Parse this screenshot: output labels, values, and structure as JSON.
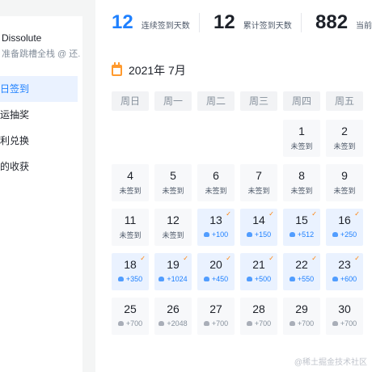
{
  "sidebar": {
    "user_name": "Dissolute",
    "user_motto": "准备跳槽全栈 @ 还...",
    "items": [
      {
        "label": "日签到",
        "active": true
      },
      {
        "label": "运抽奖",
        "active": false
      },
      {
        "label": "利兑换",
        "active": false
      },
      {
        "label": "的收获",
        "active": false
      }
    ]
  },
  "stats": [
    {
      "value": "12",
      "label": "连续签到天数",
      "color": "#1e80ff"
    },
    {
      "value": "12",
      "label": "累计签到天数",
      "color": "#1d2129"
    },
    {
      "value": "882",
      "label": "当前",
      "color": "#1d2129"
    }
  ],
  "calendar": {
    "month_title": "2021年 7月",
    "icon": "calendar-icon",
    "weekdays": [
      "周日",
      "周一",
      "周二",
      "周三",
      "周四",
      "周五"
    ],
    "unsigned_label": "未签到",
    "check_icon": "checkmark-icon",
    "ore_icon": "ore-gem-icon",
    "days": [
      {
        "day": "1",
        "status": "unsigned"
      },
      {
        "day": "2",
        "status": "unsigned"
      },
      {
        "day": "4",
        "status": "unsigned"
      },
      {
        "day": "5",
        "status": "unsigned"
      },
      {
        "day": "6",
        "status": "unsigned"
      },
      {
        "day": "7",
        "status": "unsigned"
      },
      {
        "day": "8",
        "status": "unsigned"
      },
      {
        "day": "9",
        "status": "unsigned"
      },
      {
        "day": "11",
        "status": "unsigned"
      },
      {
        "day": "12",
        "status": "unsigned"
      },
      {
        "day": "13",
        "status": "signed",
        "points": "+100"
      },
      {
        "day": "14",
        "status": "signed",
        "points": "+150"
      },
      {
        "day": "15",
        "status": "signed",
        "points": "+512"
      },
      {
        "day": "16",
        "status": "signed",
        "points": "+250"
      },
      {
        "day": "18",
        "status": "signed",
        "points": "+350"
      },
      {
        "day": "19",
        "status": "signed",
        "points": "+1024"
      },
      {
        "day": "20",
        "status": "signed",
        "points": "+450"
      },
      {
        "day": "21",
        "status": "signed",
        "points": "+500"
      },
      {
        "day": "22",
        "status": "signed",
        "points": "+550"
      },
      {
        "day": "23",
        "status": "signed",
        "points": "+600"
      },
      {
        "day": "25",
        "status": "future",
        "points": "+700"
      },
      {
        "day": "26",
        "status": "future",
        "points": "+2048"
      },
      {
        "day": "27",
        "status": "future",
        "points": "+700"
      },
      {
        "day": "28",
        "status": "future",
        "points": "+700"
      },
      {
        "day": "29",
        "status": "future",
        "points": "+700"
      },
      {
        "day": "30",
        "status": "future",
        "points": "+700"
      }
    ]
  },
  "watermark": "@稀土掘金技术社区"
}
